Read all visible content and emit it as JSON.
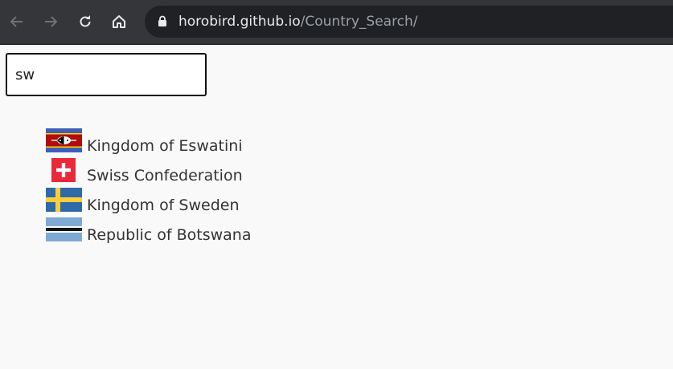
{
  "browser": {
    "url_host": "horobird.github.io",
    "url_path": "/Country_Search/"
  },
  "search": {
    "value": "sw"
  },
  "results": [
    {
      "name": "Kingdom of Eswatini",
      "flag": "eswatini-flag-icon"
    },
    {
      "name": "Swiss Confederation",
      "flag": "switzerland-flag-icon"
    },
    {
      "name": "Kingdom of Sweden",
      "flag": "sweden-flag-icon"
    },
    {
      "name": "Republic of Botswana",
      "flag": "botswana-flag-icon"
    }
  ],
  "colors": {
    "toolbar": "#35363a",
    "omnibox": "#202124",
    "page_background": "#f9f9f9"
  }
}
